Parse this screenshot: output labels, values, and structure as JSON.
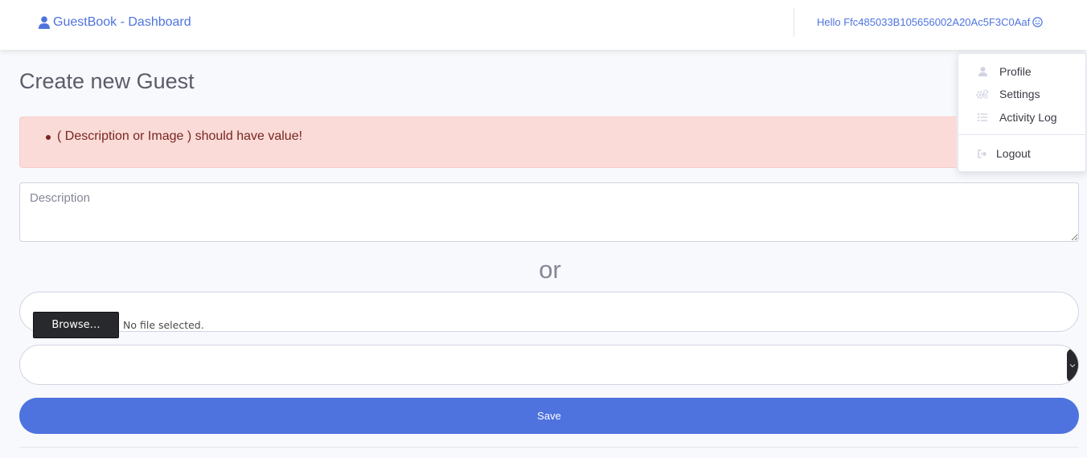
{
  "topbar": {
    "brand_text": "GuestBook - Dashboard",
    "brand_icon": "user-icon",
    "greeting": "Hello Ffc485033B105656002A20Ac5F3C0Aaf",
    "greeting_icon": "smile-icon"
  },
  "user_menu": {
    "items": [
      {
        "label": "Profile",
        "icon": "user-icon"
      },
      {
        "label": "Settings",
        "icon": "cogs-icon"
      },
      {
        "label": "Activity Log",
        "icon": "list-icon"
      },
      {
        "label": "Logout",
        "icon": "sign-out-icon"
      }
    ]
  },
  "page": {
    "title": "Create new Guest"
  },
  "alert": {
    "messages": [
      "( Description or Image ) should have value!"
    ]
  },
  "form": {
    "description_placeholder": "Description",
    "or_text": "or",
    "browse_label": "Browse…",
    "file_status": "No file selected.",
    "select_value": "",
    "save_label": "Save"
  },
  "colors": {
    "primary": "#4e73df",
    "alert_bg": "#fadbd8",
    "alert_text": "#78261f",
    "page_bg": "#f8f9fc"
  }
}
